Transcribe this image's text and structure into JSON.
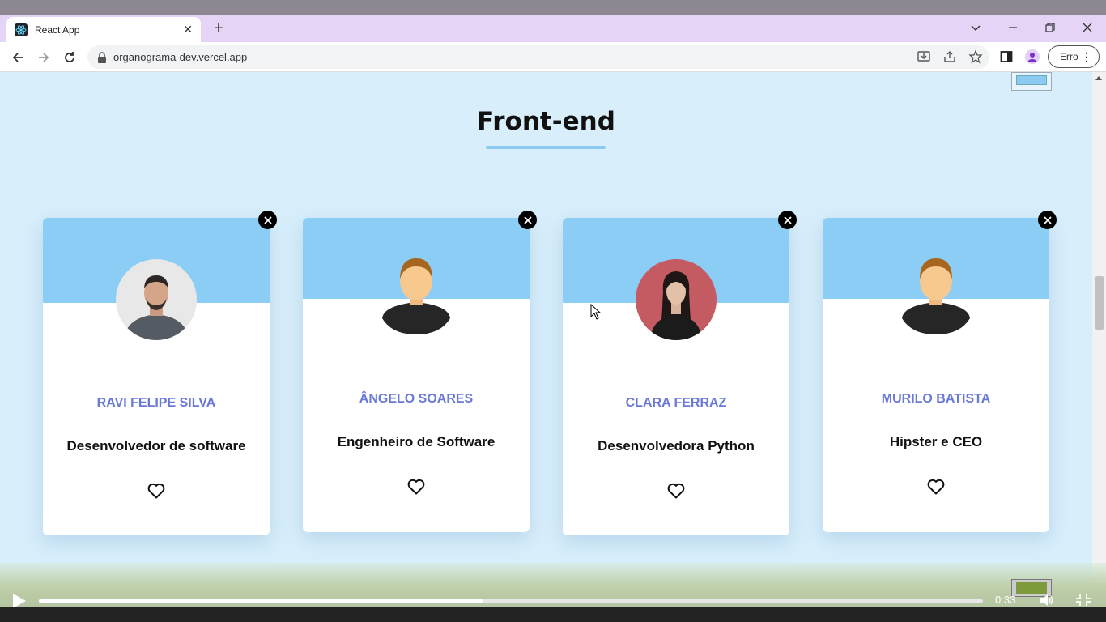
{
  "browser": {
    "tab_title": "React App",
    "tab_close": "✕",
    "new_tab": "+",
    "url": "organograma-dev.vercel.app",
    "profile_button": "Erro",
    "menu_dots": "⋮"
  },
  "page": {
    "section_title": "Front-end",
    "accent_color": "#8ccdf5",
    "cards": [
      {
        "name": "RAVI FELIPE SILVA",
        "role": "Desenvolvedor de software",
        "avatar": "photo-man-avatar"
      },
      {
        "name": "ÂNGELO SOARES",
        "role": "Engenheiro de Software",
        "avatar": "default-person-avatar"
      },
      {
        "name": "CLARA FERRAZ",
        "role": "Desenvolvedora Python",
        "avatar": "photo-woman-avatar"
      },
      {
        "name": "MURILO BATISTA",
        "role": "Hipster e CEO",
        "avatar": "default-person-avatar"
      }
    ]
  },
  "player": {
    "time": "0:33",
    "progress": 0.47
  }
}
